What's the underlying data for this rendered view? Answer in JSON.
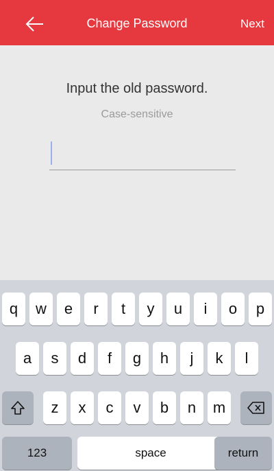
{
  "header": {
    "back_icon": "arrow-left-icon",
    "title": "Change Password",
    "next_label": "Next",
    "background": "#e5393f"
  },
  "content": {
    "prompt": "Input the old password.",
    "hint": "Case-sensitive",
    "password_value": ""
  },
  "keyboard": {
    "row1": [
      "q",
      "w",
      "e",
      "r",
      "t",
      "y",
      "u",
      "i",
      "o",
      "p"
    ],
    "row2": [
      "a",
      "s",
      "d",
      "f",
      "g",
      "h",
      "j",
      "k",
      "l"
    ],
    "row3": [
      "z",
      "x",
      "c",
      "v",
      "b",
      "n",
      "m"
    ],
    "shift_icon": "shift-icon",
    "delete_icon": "backspace-icon",
    "numbers_label": "123",
    "space_label": "space",
    "return_label": "return"
  }
}
